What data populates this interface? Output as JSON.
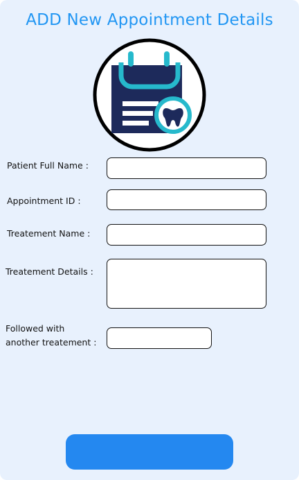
{
  "form": {
    "title": "ADD New Appointment Details",
    "logo_icon": "dental-appointment-clipboard-icon",
    "fields": [
      {
        "label": "Patient Full Name :",
        "value": "",
        "placeholder": ""
      },
      {
        "label": "Appointment ID :",
        "value": "",
        "placeholder": ""
      },
      {
        "label": "Treatement Name :",
        "value": "",
        "placeholder": ""
      },
      {
        "label": "Treatement Details :",
        "value": "",
        "placeholder": ""
      },
      {
        "label_line1": "Followed with",
        "label_line2": "another treatement :",
        "value": "",
        "placeholder": ""
      }
    ],
    "submit_label": ""
  },
  "colors": {
    "background": "#e8f1fd",
    "title": "#2196f3",
    "button": "#2488f0",
    "logo_navy": "#1d2a5b",
    "logo_teal": "#26b9cc",
    "border": "#111111"
  }
}
